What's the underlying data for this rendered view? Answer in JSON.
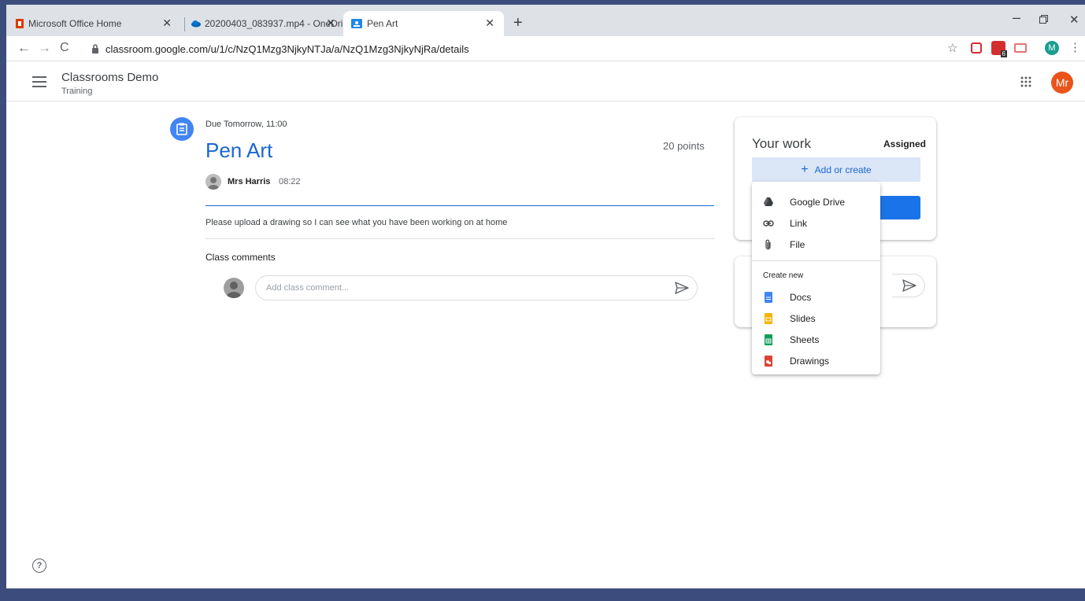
{
  "browser": {
    "tabs": [
      {
        "title": "Microsoft Office Home",
        "icon": "office-icon"
      },
      {
        "title": "20200403_083937.mp4 - OneDri",
        "icon": "onedrive-icon"
      },
      {
        "title": "Pen Art",
        "icon": "classroom-icon",
        "active": true
      }
    ],
    "close_glyph": "✕",
    "new_tab_glyph": "+",
    "url": "classroom.google.com/u/1/c/NzQ1Mzg3NjkyNTJa/a/NzQ1Mzg3NjkyNjRa/details",
    "profile_initial": "M",
    "ext_badge": "6"
  },
  "app": {
    "class_name": "Classrooms Demo",
    "section": "Training",
    "user_initials": "Mr"
  },
  "assignment": {
    "due": "Due Tomorrow, 11:00",
    "title": "Pen Art",
    "points": "20 points",
    "author": "Mrs Harris",
    "time": "08:22",
    "instructions": "Please upload a drawing so I can see what you have been working on at home",
    "comments_label": "Class comments",
    "comment_placeholder": "Add class comment..."
  },
  "your_work": {
    "title": "Your work",
    "status": "Assigned",
    "add_label": "Add or create",
    "add_glyph": "+"
  },
  "menu": {
    "items": [
      {
        "label": "Google Drive",
        "icon": "google-drive-icon"
      },
      {
        "label": "Link",
        "icon": "link-icon"
      },
      {
        "label": "File",
        "icon": "paperclip-icon"
      }
    ],
    "create_header": "Create new",
    "create_items": [
      {
        "label": "Docs",
        "icon": "docs-icon",
        "color": "#4285f4"
      },
      {
        "label": "Slides",
        "icon": "slides-icon",
        "color": "#f4b400"
      },
      {
        "label": "Sheets",
        "icon": "sheets-icon",
        "color": "#0f9d58"
      },
      {
        "label": "Drawings",
        "icon": "drawings-icon",
        "color": "#db4437"
      }
    ]
  },
  "help_glyph": "?"
}
